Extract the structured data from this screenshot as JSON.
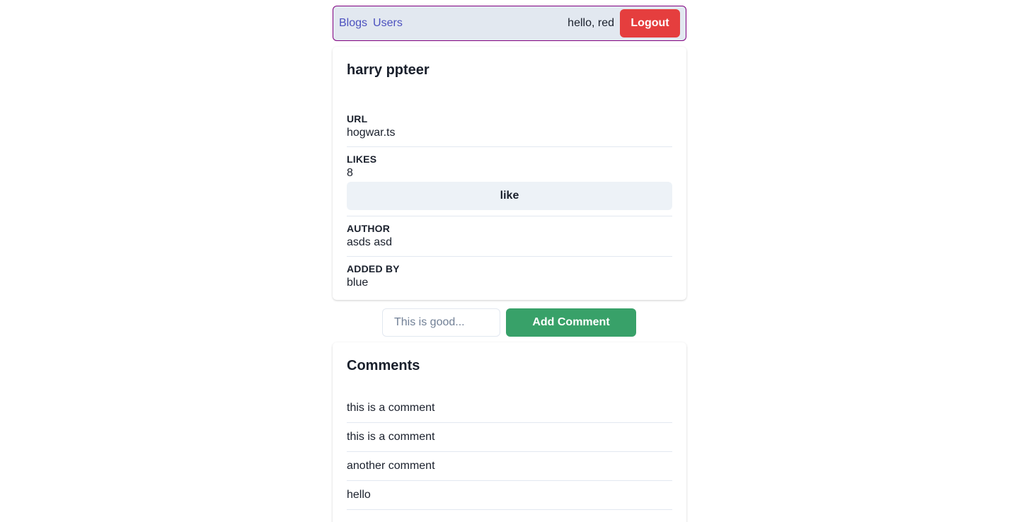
{
  "nav": {
    "blogs_label": "Blogs",
    "users_label": "Users",
    "greeting": "hello, red",
    "logout_label": "Logout"
  },
  "blog": {
    "title": "harry ppteer",
    "url_label": "URL",
    "url_value": "hogwar.ts",
    "likes_label": "LIKES",
    "likes_value": "8",
    "like_button": "like",
    "author_label": "AUTHOR",
    "author_value": "asds asd",
    "added_by_label": "ADDED BY",
    "added_by_value": "blue"
  },
  "comment_form": {
    "placeholder": "This is good...",
    "value": "",
    "submit_label": "Add Comment"
  },
  "comments": {
    "title": "Comments",
    "items": [
      "this is a comment",
      "this is a comment",
      "another comment",
      "hello"
    ]
  },
  "colors": {
    "nav_bg": "#e2e8f0",
    "nav_border": "#800080",
    "link": "#4c51bf",
    "logout": "#e53e3e",
    "add_comment": "#38a169"
  }
}
